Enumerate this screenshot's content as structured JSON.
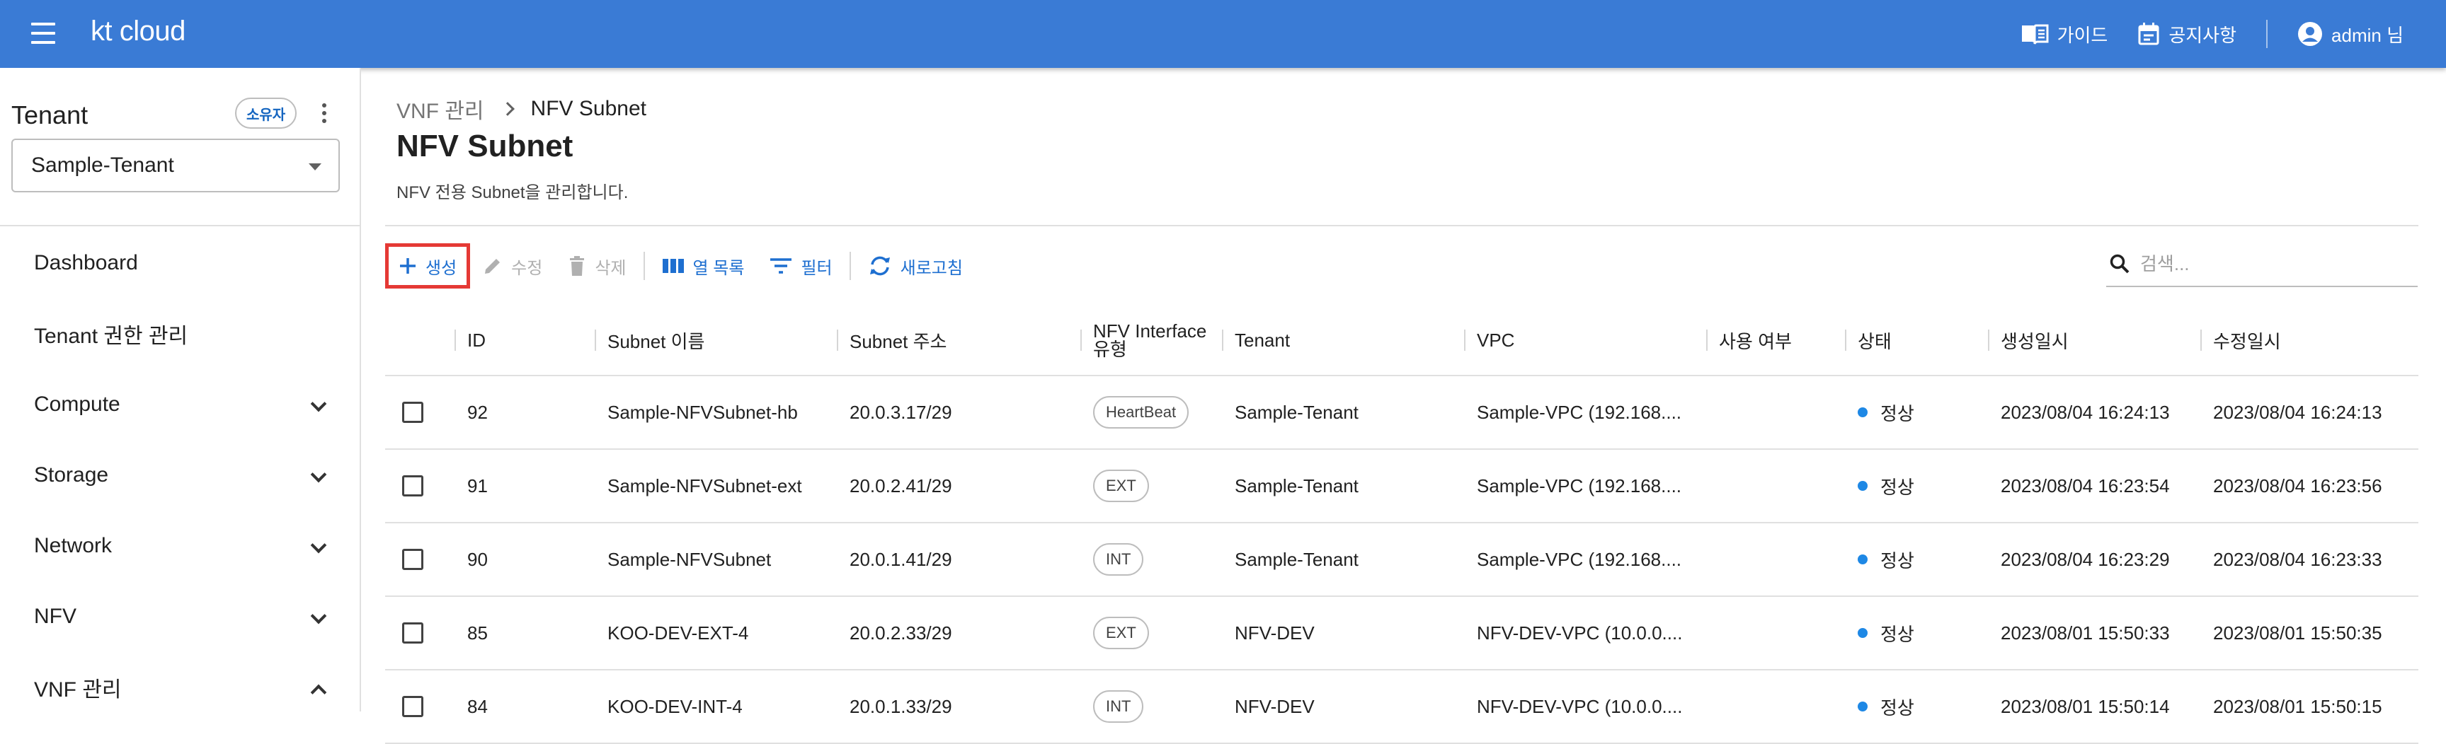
{
  "header": {
    "logo": "kt cloud",
    "guide_label": "가이드",
    "notice_label": "공지사항",
    "user_label": "admin 님"
  },
  "sidebar": {
    "tenant_title": "Tenant",
    "owner_chip": "소유자",
    "tenant_select_value": "Sample-Tenant",
    "items": [
      {
        "label": "Dashboard",
        "expandable": false
      },
      {
        "label": "Tenant 권한 관리",
        "expandable": false
      },
      {
        "label": "Compute",
        "expandable": true,
        "expanded": false
      },
      {
        "label": "Storage",
        "expandable": true,
        "expanded": false
      },
      {
        "label": "Network",
        "expandable": true,
        "expanded": false
      },
      {
        "label": "NFV",
        "expandable": true,
        "expanded": false
      },
      {
        "label": "VNF 관리",
        "expandable": true,
        "expanded": true
      }
    ]
  },
  "breadcrumb": {
    "parent": "VNF 관리",
    "current": "NFV Subnet"
  },
  "page": {
    "title": "NFV Subnet",
    "description": "NFV 전용 Subnet을 관리합니다."
  },
  "toolbar": {
    "create": "생성",
    "edit": "수정",
    "delete": "삭제",
    "columns": "열 목록",
    "filter": "필터",
    "refresh": "새로고침"
  },
  "search": {
    "placeholder": "검색..."
  },
  "table": {
    "headers": {
      "id": "ID",
      "subnet_name": "Subnet 이름",
      "subnet_addr": "Subnet 주소",
      "nfv_type_1": "NFV Interface",
      "nfv_type_2": "유형",
      "tenant": "Tenant",
      "vpc": "VPC",
      "in_use": "사용 여부",
      "status": "상태",
      "created": "생성일시",
      "modified": "수정일시"
    },
    "rows": [
      {
        "id": "92",
        "name": "Sample-NFVSubnet-hb",
        "addr": "20.0.3.17/29",
        "type": "HeartBeat",
        "tenant": "Sample-Tenant",
        "vpc": "Sample-VPC (192.168....",
        "in_use": "",
        "status": "정상",
        "created": "2023/08/04 16:24:13",
        "modified": "2023/08/04 16:24:13"
      },
      {
        "id": "91",
        "name": "Sample-NFVSubnet-ext",
        "addr": "20.0.2.41/29",
        "type": "EXT",
        "tenant": "Sample-Tenant",
        "vpc": "Sample-VPC (192.168....",
        "in_use": "",
        "status": "정상",
        "created": "2023/08/04 16:23:54",
        "modified": "2023/08/04 16:23:56"
      },
      {
        "id": "90",
        "name": "Sample-NFVSubnet",
        "addr": "20.0.1.41/29",
        "type": "INT",
        "tenant": "Sample-Tenant",
        "vpc": "Sample-VPC (192.168....",
        "in_use": "",
        "status": "정상",
        "created": "2023/08/04 16:23:29",
        "modified": "2023/08/04 16:23:33"
      },
      {
        "id": "85",
        "name": "KOO-DEV-EXT-4",
        "addr": "20.0.2.33/29",
        "type": "EXT",
        "tenant": "NFV-DEV",
        "vpc": "NFV-DEV-VPC (10.0.0....",
        "in_use": "",
        "status": "정상",
        "created": "2023/08/01 15:50:33",
        "modified": "2023/08/01 15:50:35"
      },
      {
        "id": "84",
        "name": "KOO-DEV-INT-4",
        "addr": "20.0.1.33/29",
        "type": "INT",
        "tenant": "NFV-DEV",
        "vpc": "NFV-DEV-VPC (10.0.0....",
        "in_use": "",
        "status": "정상",
        "created": "2023/08/01 15:50:14",
        "modified": "2023/08/01 15:50:15"
      }
    ]
  },
  "colors": {
    "header_bg": "#3a7bd5",
    "accent": "#1e6fd0",
    "status_dot": "#1e88e5",
    "highlight_box": "#e53935"
  }
}
